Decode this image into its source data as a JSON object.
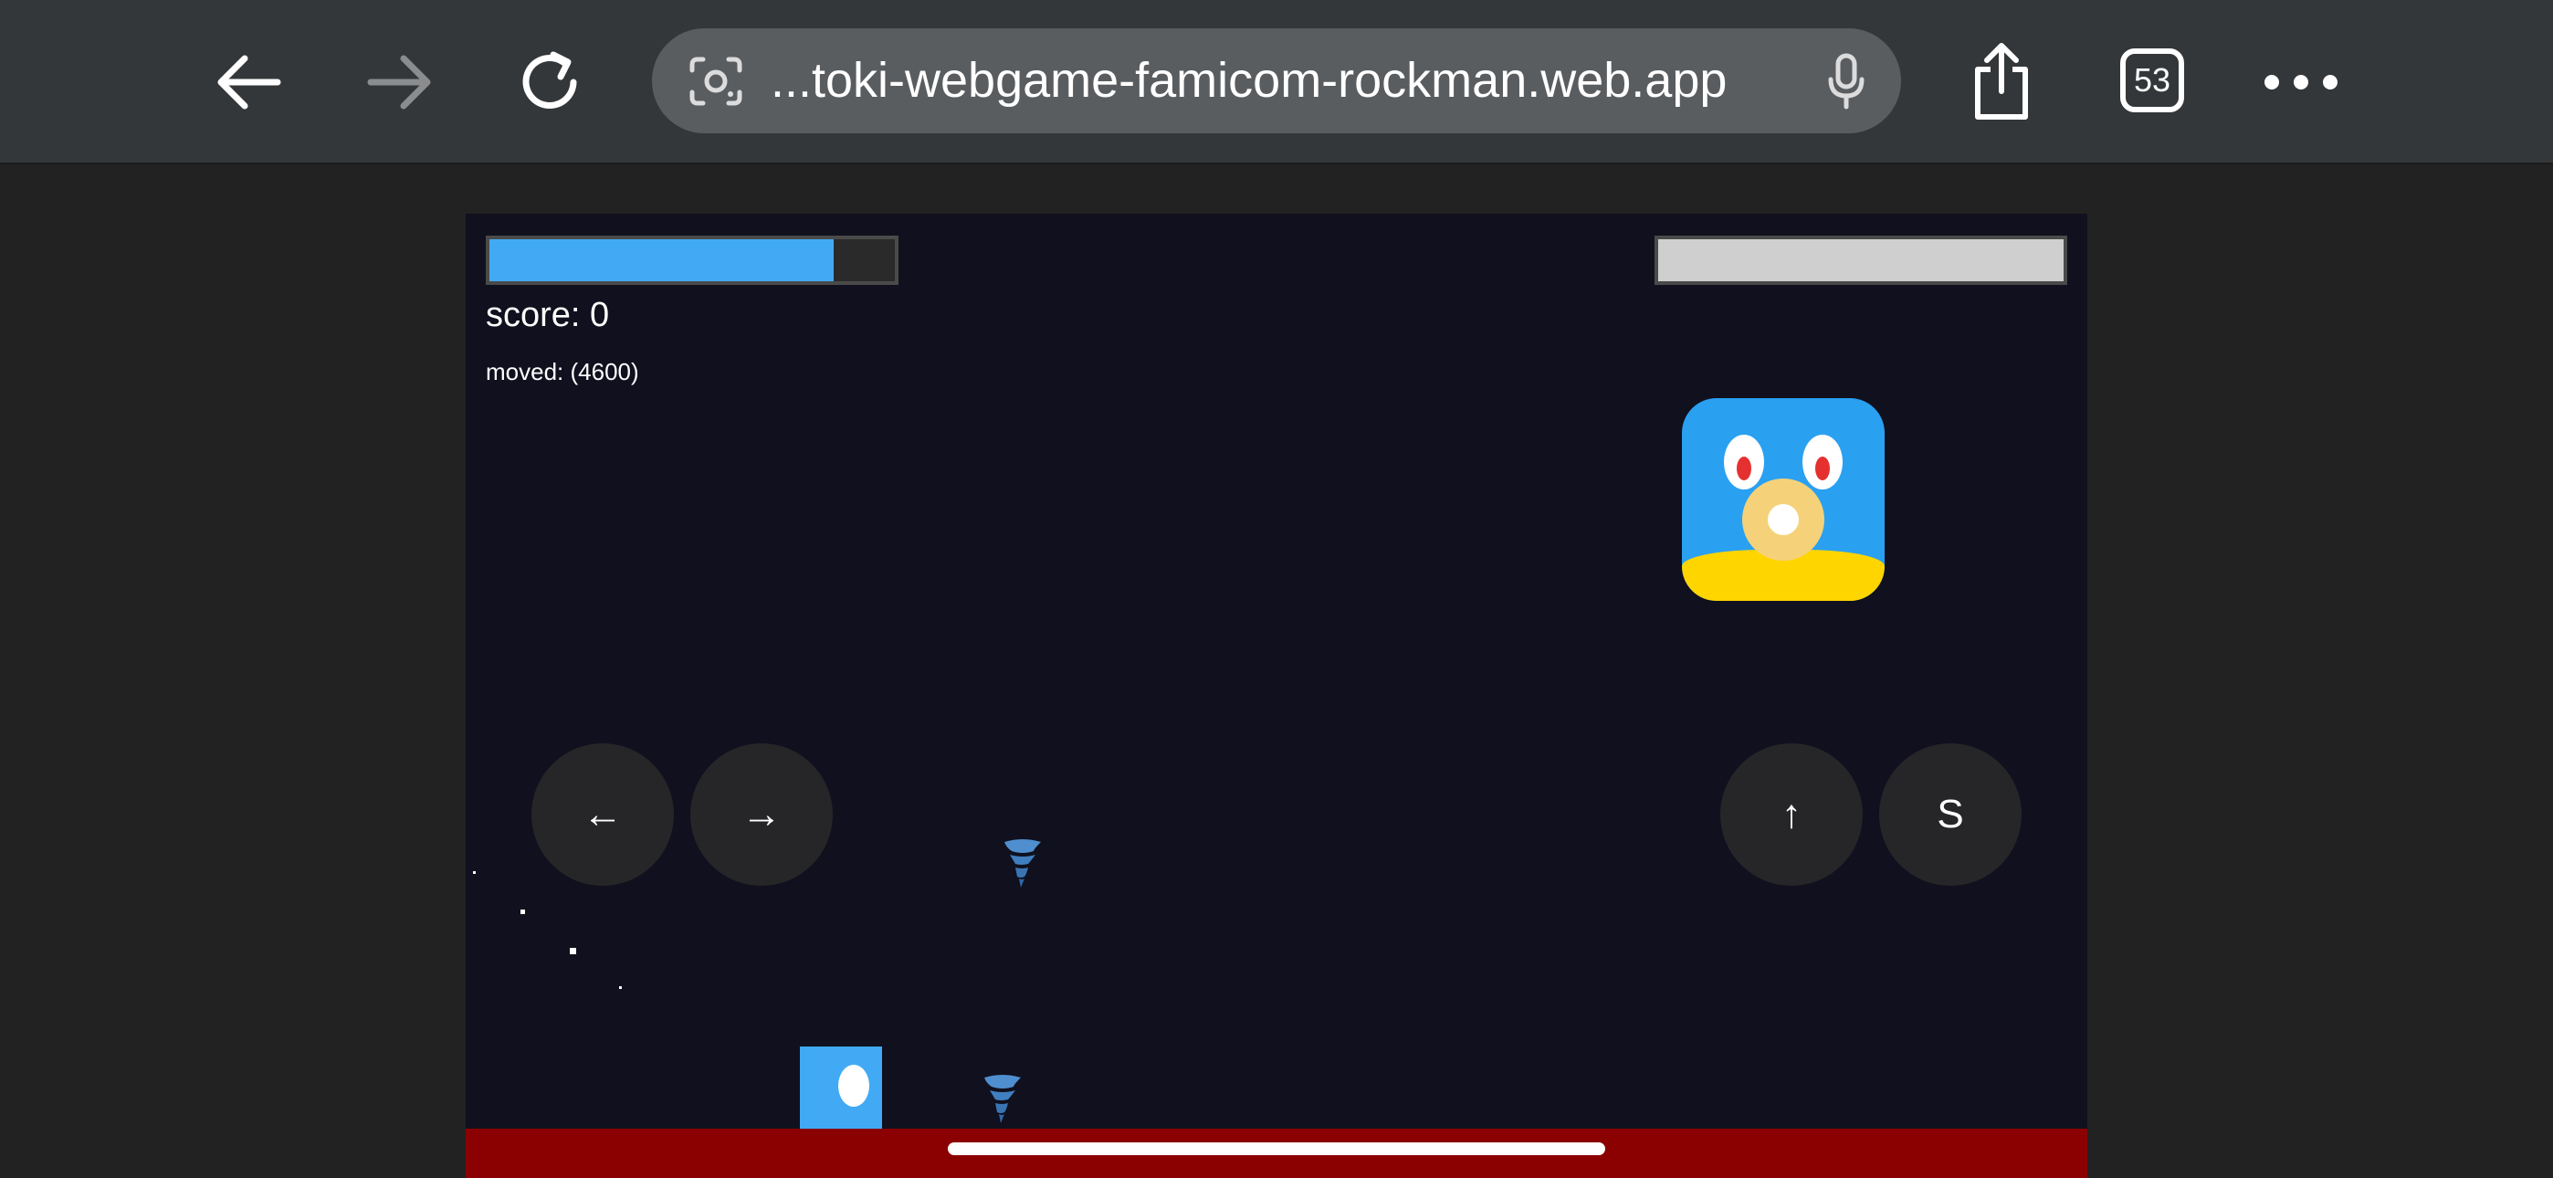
{
  "browser": {
    "url_text": "...toki-webgame-famicom-rockman.web.app",
    "tab_count": "53",
    "icons": {
      "back": "back-arrow-icon",
      "forward": "forward-arrow-icon",
      "reload": "reload-icon",
      "lens": "lens-icon",
      "mic": "microphone-icon",
      "share": "share-icon",
      "more": "more-icon"
    }
  },
  "game": {
    "player_hp": 0.85,
    "enemy_hp": 1.0,
    "score_text": "score: 0",
    "moved_text": "moved: (4600)",
    "controls": {
      "left_label": "←",
      "right_label": "→",
      "jump_label": "↑",
      "shoot_label": "S"
    },
    "colors": {
      "background": "#10101e",
      "player": "#42aaf5",
      "floor": "#8b0000",
      "boss_body": "#2aa0f0",
      "boss_bottom": "#ffd500",
      "enemy_bar": "#cfcfcf"
    }
  }
}
